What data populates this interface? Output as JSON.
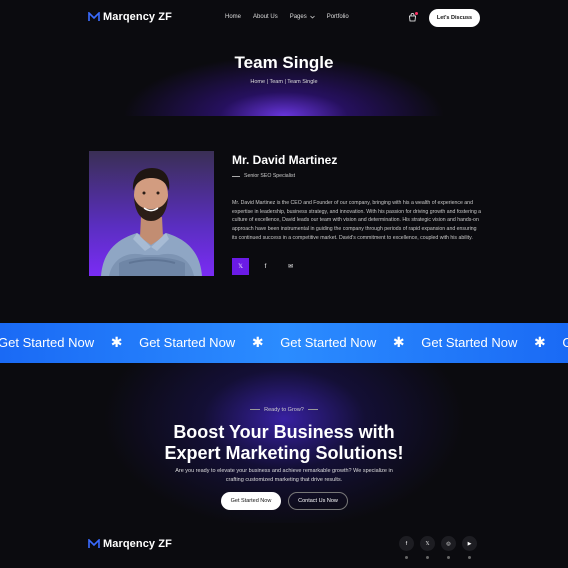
{
  "header": {
    "logo_text": "Marqency ZF",
    "nav": [
      {
        "label": "Home"
      },
      {
        "label": "About Us"
      },
      {
        "label": "Pages",
        "has_dropdown": true
      },
      {
        "label": "Portfolio"
      }
    ],
    "cart_icon": "shopping-bag-icon",
    "cta_label": "Let's Discuss"
  },
  "hero": {
    "title": "Team Single",
    "breadcrumb": "Home | Team | Team Single"
  },
  "profile": {
    "photo_icon": "person-photo",
    "name": "Mr. David Martinez",
    "role": "Senior SEO Specialist",
    "bio": "Mr. David Martinez is the CEO and Founder of our company, bringing with his a wealth of experience and expertise in leadership, business strategy, and innovation. With his passion for driving growth and fostering a culture of excellence, David leads our team with vision and determination. His strategic vision and hands-on approach have been instrumental in guiding the company through periods of rapid expansion and ensuring its continued success in a competitive market. David's commitment to excellence, coupled with his ability.",
    "social": [
      {
        "icon": "x-icon",
        "glyph": "𝕏",
        "active": true
      },
      {
        "icon": "facebook-icon",
        "glyph": "f",
        "active": false
      },
      {
        "icon": "mail-icon",
        "glyph": "✉",
        "active": false
      }
    ]
  },
  "band": {
    "text": "Get Started Now",
    "separator": "✱",
    "color": "#1a6af5"
  },
  "cta": {
    "eyebrow": "Ready to Grow?",
    "title_line1": "Boost Your Business with",
    "title_line2": "Expert Marketing Solutions!",
    "subtitle": "Are you ready to elevate your business and achieve remarkable growth? We specialize in crafting customized marketing that drive results.",
    "primary_label": "Get Started Now",
    "secondary_label": "Contact Us Now"
  },
  "footer": {
    "logo_text": "Marqency ZF",
    "social": [
      {
        "icon": "facebook-icon",
        "glyph": "f"
      },
      {
        "icon": "x-icon",
        "glyph": "𝕏"
      },
      {
        "icon": "instagram-icon",
        "glyph": "◎"
      },
      {
        "icon": "youtube-icon",
        "glyph": "▶"
      }
    ]
  },
  "colors": {
    "accent_purple": "#6b1be6",
    "background": "#0b0b0f",
    "band_blue": "#1a6af5"
  }
}
